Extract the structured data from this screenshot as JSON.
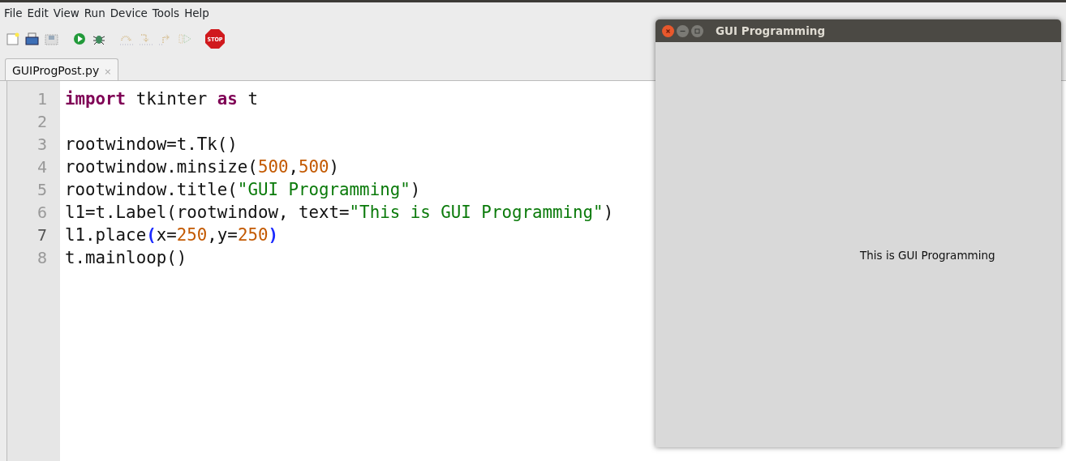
{
  "menu": [
    "File",
    "Edit",
    "View",
    "Run",
    "Device",
    "Tools",
    "Help"
  ],
  "toolbar": [
    {
      "kind": "new",
      "disabled": false
    },
    {
      "kind": "save",
      "disabled": false
    },
    {
      "kind": "saveall",
      "disabled": false
    },
    {
      "kind": "run",
      "disabled": false
    },
    {
      "kind": "debug",
      "disabled": false
    },
    {
      "kind": "stepover",
      "disabled": true
    },
    {
      "kind": "stepinto",
      "disabled": true
    },
    {
      "kind": "stepout",
      "disabled": true
    },
    {
      "kind": "resume",
      "disabled": true
    },
    {
      "kind": "stop",
      "disabled": false,
      "label": "STOP"
    }
  ],
  "tabs": [
    {
      "label": "GUIProgPost.py",
      "close": "×",
      "selected": true
    }
  ],
  "editor": {
    "lines": [
      {
        "number": "1",
        "current": false,
        "tokens": [
          {
            "text": "import",
            "kind": "keyword"
          },
          {
            "text": " tkinter ",
            "kind": "plain"
          },
          {
            "text": "as",
            "kind": "keyword"
          },
          {
            "text": " t",
            "kind": "plain"
          }
        ]
      },
      {
        "number": "2",
        "current": false
      },
      {
        "number": "3",
        "current": false,
        "tokens": [
          {
            "text": "rootwindow=t.Tk()",
            "kind": "plain"
          }
        ]
      },
      {
        "number": "4",
        "current": false,
        "tokens": [
          {
            "text": "rootwindow.minsize(",
            "kind": "plain"
          },
          {
            "text": "500",
            "kind": "number"
          },
          {
            "text": ",",
            "kind": "plain"
          },
          {
            "text": "500",
            "kind": "number"
          },
          {
            "text": ")",
            "kind": "plain"
          }
        ]
      },
      {
        "number": "5",
        "current": false,
        "tokens": [
          {
            "text": "rootwindow.title(",
            "kind": "plain"
          },
          {
            "text": "\"GUI Programming\"",
            "kind": "string"
          },
          {
            "text": ")",
            "kind": "plain"
          }
        ]
      },
      {
        "number": "6",
        "current": false,
        "tokens": [
          {
            "text": "l1=t.Label(rootwindow, text=",
            "kind": "plain"
          },
          {
            "text": "\"This is GUI Programming\"",
            "kind": "string"
          },
          {
            "text": ")",
            "kind": "plain"
          }
        ]
      },
      {
        "number": "7",
        "current": true,
        "tokens": [
          {
            "text": "l1.place",
            "kind": "plain"
          },
          {
            "text": "(",
            "kind": "bracket"
          },
          {
            "text": "x=",
            "kind": "plain"
          },
          {
            "text": "250",
            "kind": "number"
          },
          {
            "text": ",y=",
            "kind": "plain"
          },
          {
            "text": "250",
            "kind": "number"
          },
          {
            "text": ")",
            "kind": "bracket"
          }
        ]
      },
      {
        "number": "8",
        "current": false,
        "tokens": [
          {
            "text": "t.mainloop()",
            "kind": "plain"
          }
        ]
      }
    ]
  },
  "app_window": {
    "title": "GUI Programming",
    "label": "This is GUI Programming"
  }
}
